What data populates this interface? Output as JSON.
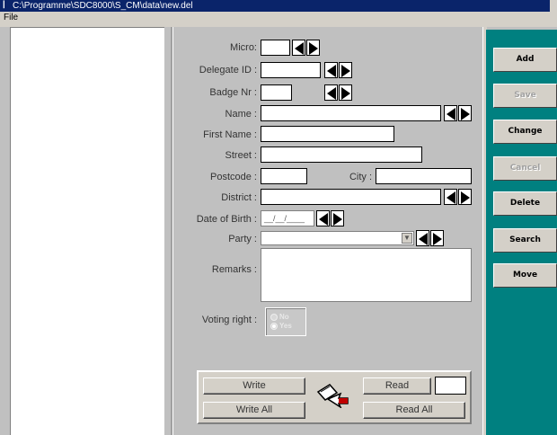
{
  "window": {
    "title": "C:\\Programme\\SDC8000\\S_CM\\data\\new.del",
    "app_icon": "app-icon"
  },
  "menu": {
    "items": [
      {
        "label": "File"
      }
    ]
  },
  "form": {
    "micro_label": "Micro:",
    "delegate_id_label": "Delegate ID :",
    "badge_nr_label": "Badge Nr :",
    "name_label": "Name :",
    "first_name_label": "First Name :",
    "street_label": "Street :",
    "postcode_label": "Postcode :",
    "city_label": "City :",
    "district_label": "District :",
    "date_of_birth_label": "Date of Birth :",
    "date_of_birth_value": "__/__/____",
    "party_label": "Party :",
    "remarks_label": "Remarks :",
    "voting_right_label": "Voting right :",
    "voting_options": [
      {
        "label": "No",
        "checked": false
      },
      {
        "label": "Yes",
        "checked": true
      }
    ]
  },
  "bottom": {
    "write_label": "Write",
    "write_all_label": "Write All",
    "read_label": "Read",
    "read_all_label": "Read All"
  },
  "sidebar": {
    "buttons": [
      {
        "label": "Add",
        "enabled": true
      },
      {
        "label": "Save",
        "enabled": false
      },
      {
        "label": "Change",
        "enabled": true
      },
      {
        "label": "Cancel",
        "enabled": false
      },
      {
        "label": "Delete",
        "enabled": true
      },
      {
        "label": "Search",
        "enabled": true
      },
      {
        "label": "Move",
        "enabled": true
      }
    ]
  },
  "colors": {
    "title_bar": "#0a246a",
    "sidebar_bg": "#008080",
    "form_bg": "#c0c0c0"
  }
}
